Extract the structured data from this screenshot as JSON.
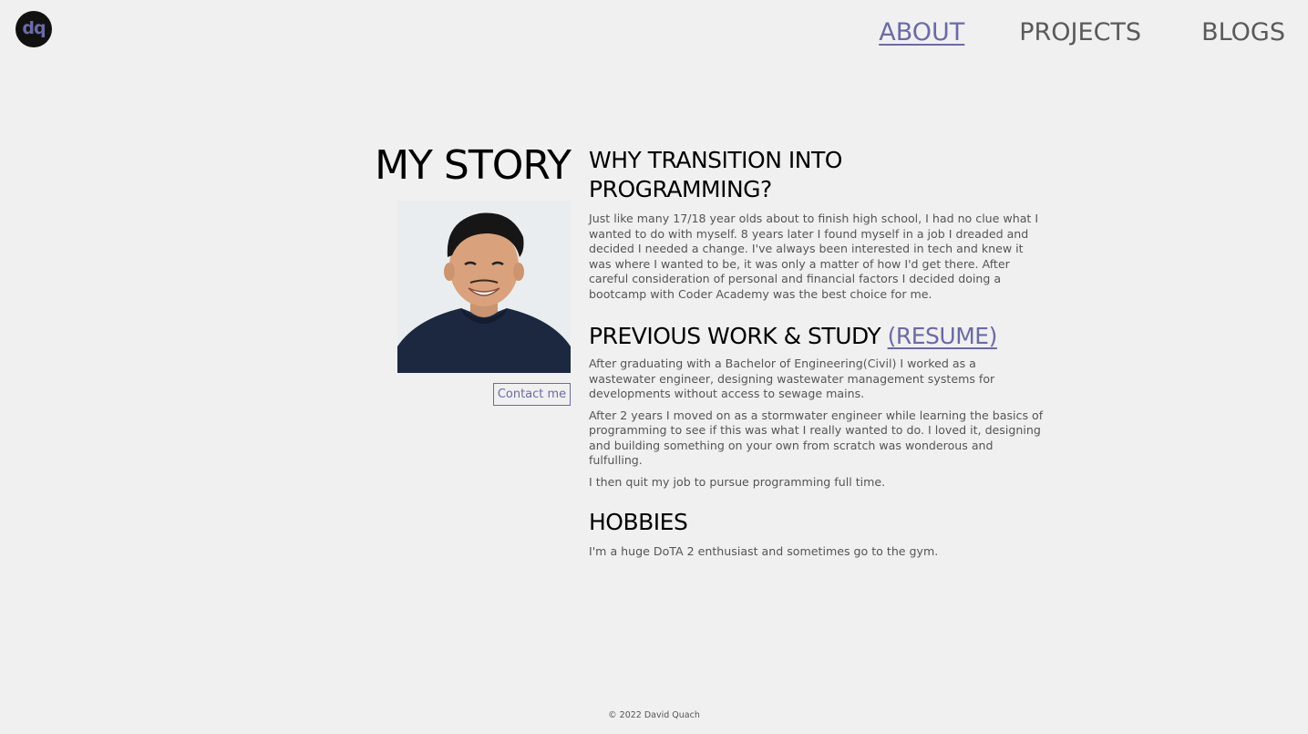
{
  "logo": {
    "text": "dq"
  },
  "nav": {
    "about": "ABOUT",
    "projects": "PROJECTS",
    "blogs": "BLOGS"
  },
  "story": {
    "title": "MY STORY",
    "contact_label": "Contact me"
  },
  "sections": {
    "why": {
      "heading": "WHY TRANSITION INTO PROGRAMMING?",
      "body": "Just like many 17/18 year olds about to finish high school, I had no clue what I wanted to do with myself. 8 years later I found myself in a job I dreaded and decided I needed a change. I've always been interested in tech and knew it was where I wanted to be, it was only a matter of how I'd get there. After careful consideration of personal and financial factors I decided doing a bootcamp with Coder Academy was the best choice for me."
    },
    "previous": {
      "heading": "PREVIOUS WORK & STUDY",
      "resume_link": "(RESUME)",
      "p1": "After graduating with a Bachelor of Engineering(Civil) I worked as a wastewater engineer, designing wastewater management systems for developments without access to sewage mains.",
      "p2": "After 2 years I moved on as a stormwater engineer while learning the basics of programming to see if this was what I really wanted to do. I loved it, designing and building something on your own from scratch was wonderous and fulfulling.",
      "p3": "I then quit my job to pursue programming full time."
    },
    "hobbies": {
      "heading": "HOBBIES",
      "body": "I'm a huge DoTA 2 enthusiast and sometimes go to the gym."
    }
  },
  "footer": {
    "text": "© 2022 David Quach"
  },
  "colors": {
    "accent": "#6b6aa8",
    "background": "#f0f0f0",
    "text": "#555555"
  }
}
